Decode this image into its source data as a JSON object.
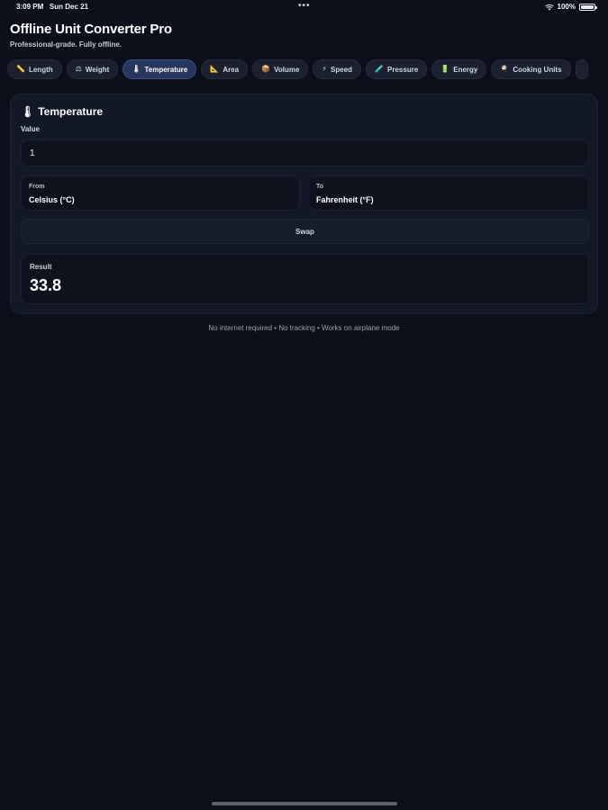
{
  "status_bar": {
    "time": "3:09 PM",
    "date": "Sun Dec 21",
    "battery": "100%",
    "dots": "•••",
    "icons": [
      "wifi-icon",
      "battery-icon"
    ]
  },
  "app": {
    "title": "Offline Unit Converter Pro",
    "subtitle": "Professional-grade. Fully offline."
  },
  "tabs": [
    {
      "label": "Length",
      "icon": "📏"
    },
    {
      "label": "Weight",
      "icon": "⚖"
    },
    {
      "label": "Temperature",
      "icon": "🌡",
      "active": true
    },
    {
      "label": "Area",
      "icon": "📐"
    },
    {
      "label": "Volume",
      "icon": "📦"
    },
    {
      "label": "Speed",
      "icon": "⚡"
    },
    {
      "label": "Pressure",
      "icon": "🧪"
    },
    {
      "label": "Energy",
      "icon": "🔋"
    },
    {
      "label": "Cooking Units",
      "icon": "🍳"
    }
  ],
  "card": {
    "icon": "🌡",
    "title": "Temperature",
    "value_label": "Value",
    "value": "1",
    "from_label": "From",
    "from_value": "Celsius (°C)",
    "to_label": "To",
    "to_value": "Fahrenheit (°F)",
    "swap_label": "Swap",
    "result_label": "Result",
    "result_value": "33.8"
  },
  "footer": "No internet required • No tracking • Works on airplane mode",
  "colors": {
    "background": "#0b0f19",
    "card": "#121827",
    "active_tab": "#26365e"
  }
}
